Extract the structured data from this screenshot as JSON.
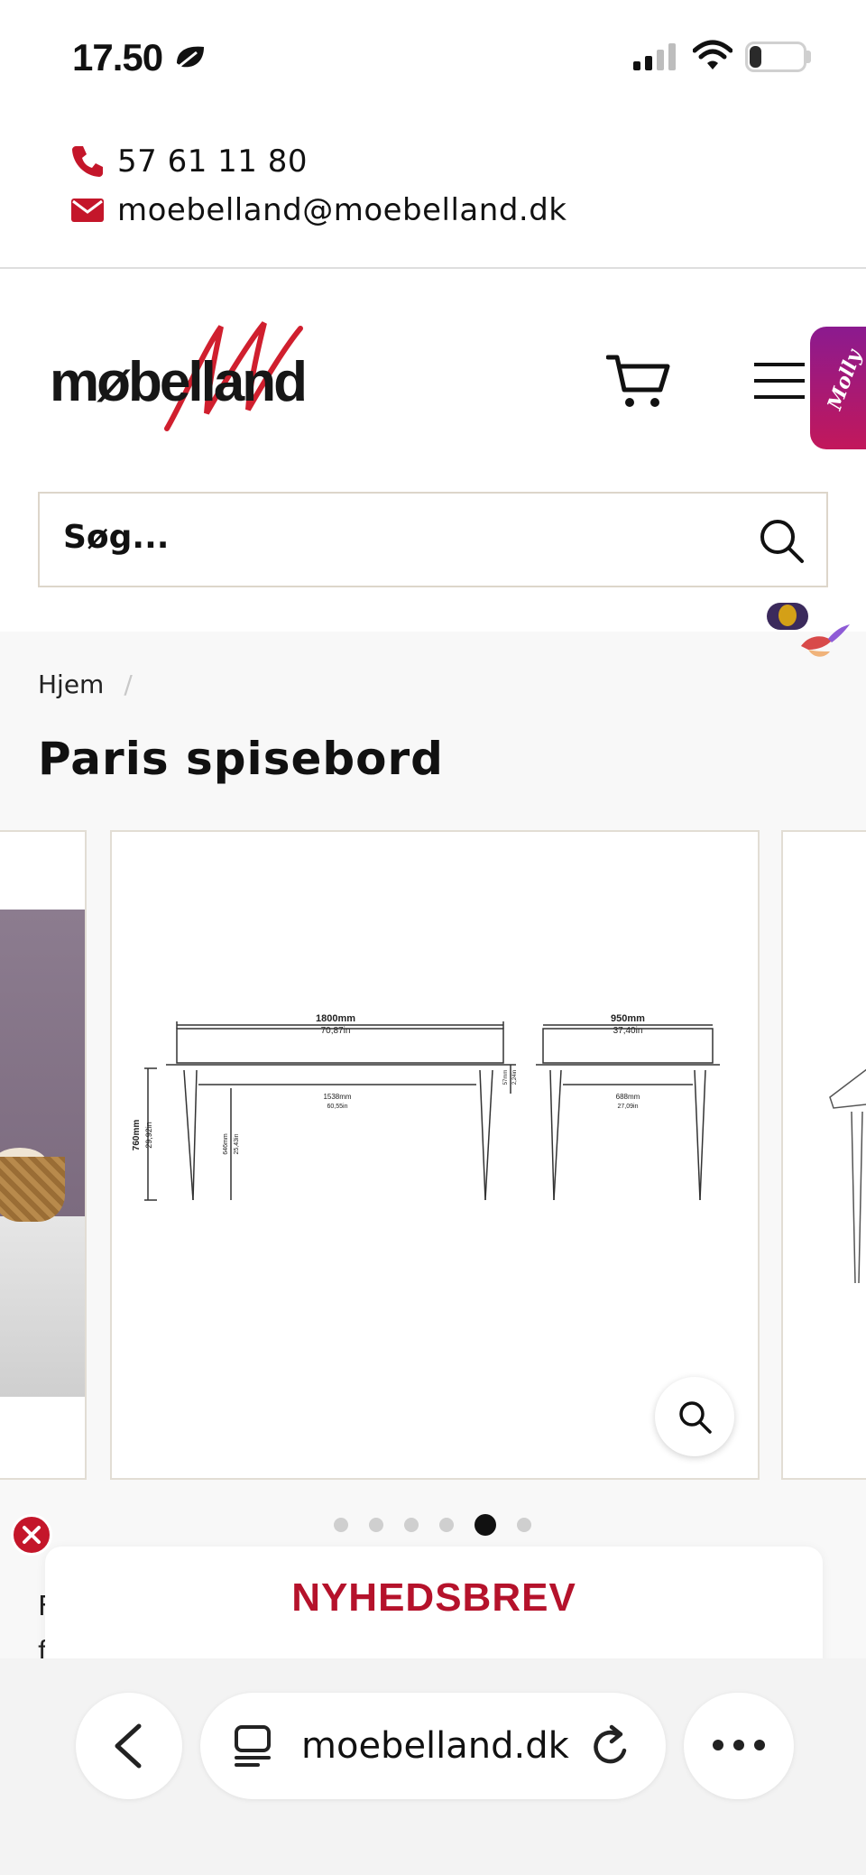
{
  "status_bar": {
    "time": "17.50",
    "battery": "22",
    "battery_level": 0.22,
    "icons": [
      "focus-leaf-icon",
      "cellular-signal-icon",
      "wifi-icon",
      "battery-icon"
    ]
  },
  "contact": {
    "phone": "57 61 11 80",
    "email": "moebelland@moebelland.dk",
    "icons": [
      "phone-icon",
      "mail-icon"
    ],
    "icon_color": "#c4162a"
  },
  "header": {
    "logo_text": "møbelland",
    "molly_label": "Molly",
    "icons": [
      "cart-icon",
      "hamburger-menu-icon"
    ]
  },
  "search": {
    "placeholder": "Søg..."
  },
  "breadcrumb": {
    "items": [
      "Hjem"
    ],
    "separator": "/"
  },
  "product": {
    "title": "Paris spisebord"
  },
  "gallery": {
    "slide_count": 6,
    "active_index": 4,
    "drawing": {
      "length_mm": "1800mm",
      "length_in": "70,87in",
      "width_mm": "950mm",
      "width_in": "37,40in",
      "height_mm": "760mm",
      "height_in": "29,92in",
      "inner_length_mm": "1538mm",
      "inner_length_in": "60,55in",
      "inner_width_mm": "688mm",
      "inner_width_in": "27,09in",
      "leg_height_mm": "646mm",
      "leg_height_in": "25,43in",
      "apron_mm": "57mm",
      "apron_in": "2,24in"
    }
  },
  "behind_text": {
    "line1": "F",
    "line2": "f"
  },
  "newsletter": {
    "title": "NYHEDSBREV",
    "color": "#b5122b"
  },
  "browser": {
    "url": "moebelland.dk",
    "icons": [
      "back-chevron-icon",
      "page-menu-icon",
      "reload-icon",
      "more-dots-icon"
    ]
  }
}
